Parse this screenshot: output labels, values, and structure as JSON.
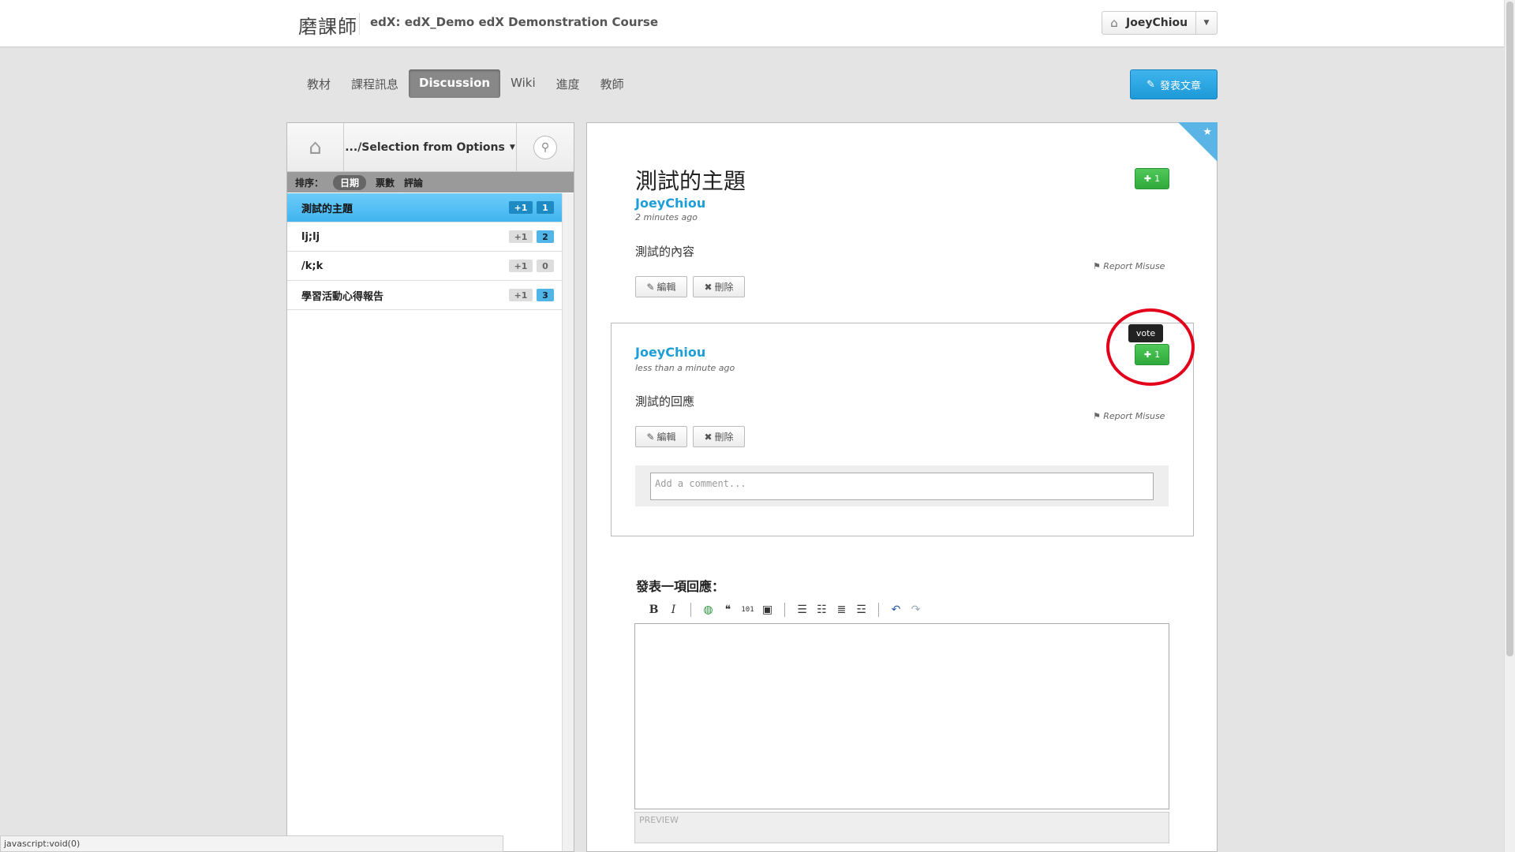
{
  "header": {
    "logo": "磨課師",
    "course_title": "edX: edX_Demo edX Demonstration Course",
    "user": "JoeyChiou"
  },
  "course_nav": {
    "tabs": [
      "教材",
      "課程訊息",
      "Discussion",
      "Wiki",
      "進度",
      "教師"
    ],
    "active": "Discussion",
    "new_post_label": "發表文章"
  },
  "sidebar": {
    "filter_label": ".../Selection from Options",
    "sort_label": "排序：",
    "sort_options": [
      "日期",
      "票數",
      "評論"
    ],
    "threads": [
      {
        "title": "測試的主題",
        "votes": "+1",
        "comments": "1"
      },
      {
        "title": "lj;lj",
        "votes": "+1",
        "comments": "2"
      },
      {
        "title": "/k;k",
        "votes": "+1",
        "comments": "0"
      },
      {
        "title": "學習活動心得報告",
        "votes": "+1",
        "comments": "3"
      }
    ]
  },
  "post": {
    "title": "測試的主題",
    "author": "JoeyChiou",
    "time": "2 minutes ago",
    "body": "測試的內容",
    "vote_count": "1",
    "report_label": "Report Misuse",
    "edit_label": "編輯",
    "delete_label": "刪除"
  },
  "response": {
    "author": "JoeyChiou",
    "time": "less than a minute ago",
    "body": "測試的回應",
    "vote_count": "1",
    "tooltip": "vote",
    "report_label": "Report Misuse",
    "edit_label": "編輯",
    "delete_label": "刪除",
    "comment_placeholder": "Add a comment..."
  },
  "reply": {
    "label": "發表一項回應：",
    "preview_label": "PREVIEW"
  },
  "status_bar": "javascript:void(0)",
  "colors": {
    "accent_blue": "#1e9ed8",
    "vote_green": "#30a93b",
    "highlight_red": "#e3001b"
  }
}
